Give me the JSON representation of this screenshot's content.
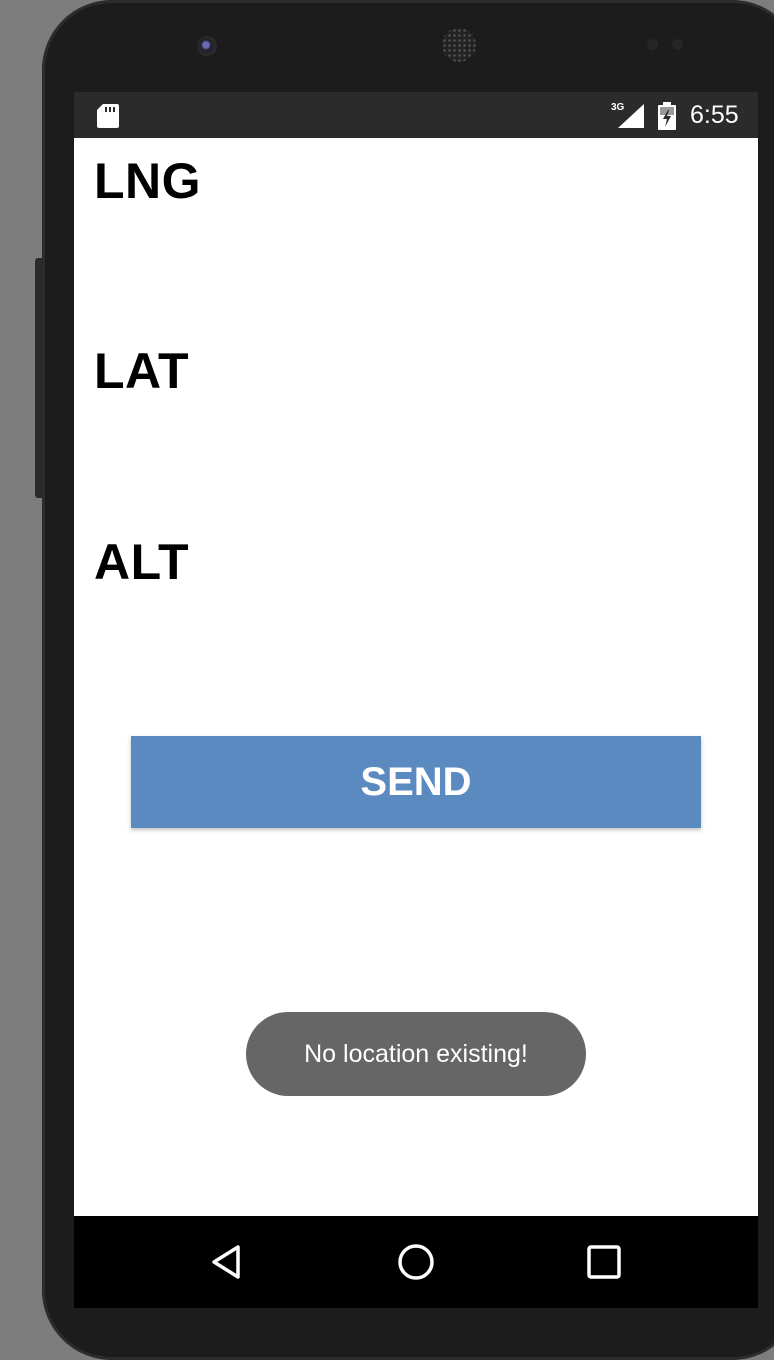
{
  "status_bar": {
    "network_type": "3G",
    "time": "6:55",
    "icons": [
      "sd-card-icon",
      "cellular-signal-icon",
      "battery-charging-icon"
    ]
  },
  "labels": {
    "lng": "LNG",
    "lat": "LAT",
    "alt": "ALT"
  },
  "send_button": {
    "label": "SEND",
    "color": "#5b8ac0"
  },
  "toast": {
    "message": "No location existing!"
  },
  "nav_bar": {
    "icons": [
      "back-icon",
      "home-icon",
      "recents-icon"
    ]
  }
}
